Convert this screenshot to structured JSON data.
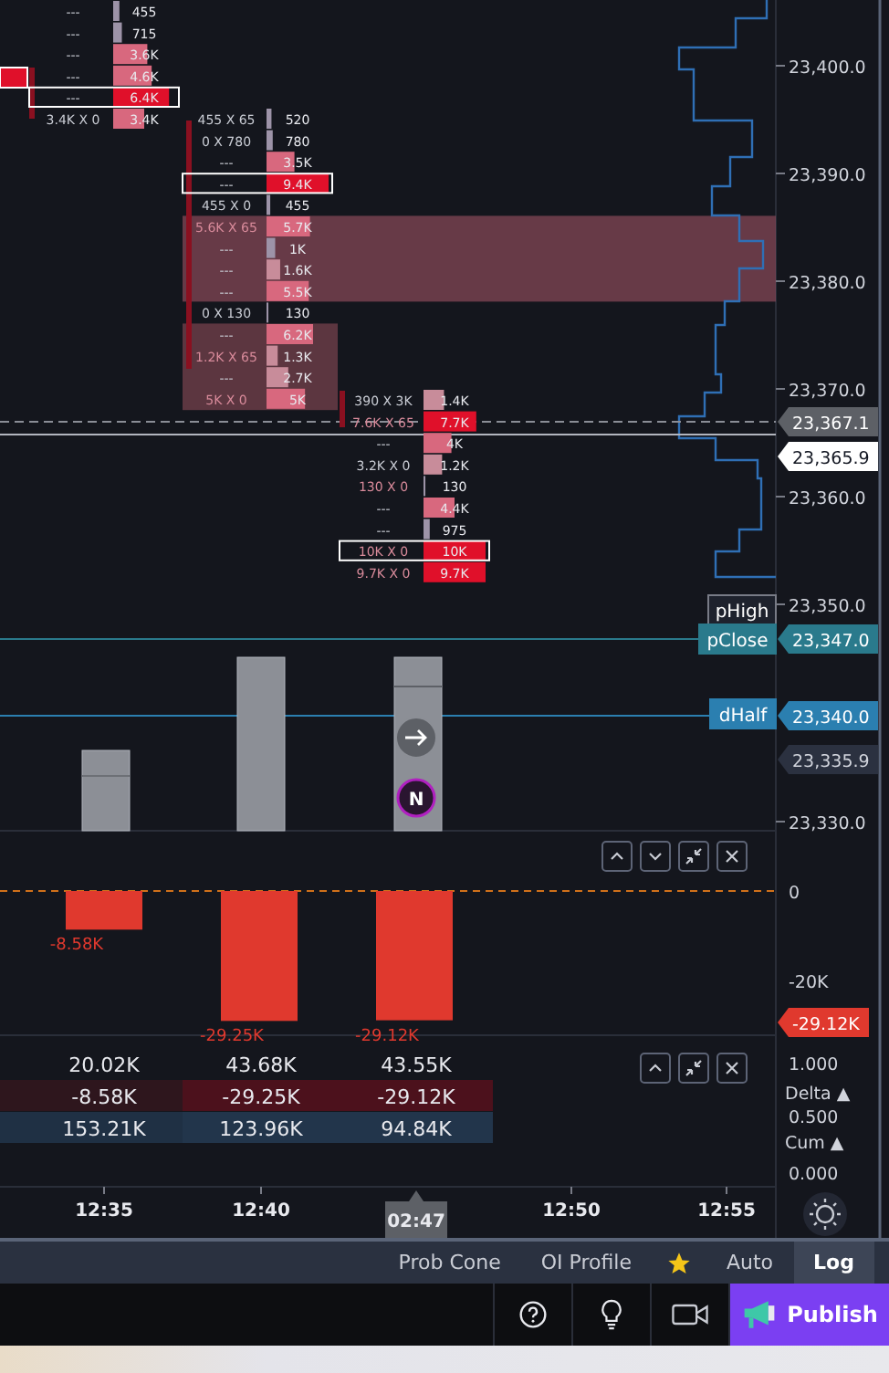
{
  "price_axis": {
    "ticks": [
      "23,400.0",
      "23,390.0",
      "23,380.0",
      "23,370.0",
      "23,360.0",
      "23,350.0",
      "23,330.0"
    ],
    "tags": [
      {
        "text": "23,367.1",
        "kind": "last"
      },
      {
        "text": "23,365.9",
        "kind": "current"
      },
      {
        "text": "23,347.0",
        "kind": "pclose"
      },
      {
        "text": "23,340.0",
        "kind": "dhalf"
      },
      {
        "text": "23,335.9",
        "kind": "marker"
      }
    ]
  },
  "level_labels": [
    {
      "text": "pHigh",
      "kind": "phigh"
    },
    {
      "text": "pClose",
      "kind": "pclose"
    },
    {
      "text": "dHalf",
      "kind": "dhalf"
    }
  ],
  "footprint": [
    {
      "rows": [
        {
          "bid_ask": "---",
          "volume": "455",
          "level": 0.1,
          "boxed": false,
          "bid_heavy": false
        },
        {
          "bid_ask": "---",
          "volume": "715",
          "level": 0.14,
          "boxed": false,
          "bid_heavy": false
        },
        {
          "bid_ask": "---",
          "volume": "3.6K",
          "level": 0.55,
          "boxed": false,
          "bid_heavy": false
        },
        {
          "bid_ask": "---",
          "volume": "4.6K",
          "level": 0.62,
          "boxed": false,
          "bid_heavy": false
        },
        {
          "bid_ask": "---",
          "volume": "6.4K",
          "level": 0.9,
          "boxed": true,
          "bid_heavy": false
        },
        {
          "bid_ask": "3.4K X 0",
          "volume": "3.4K",
          "level": 0.5,
          "boxed": false,
          "bid_heavy": false
        }
      ]
    },
    {
      "rows": [
        {
          "bid_ask": "455 X 65",
          "volume": "520",
          "level": 0.08,
          "boxed": false,
          "bid_heavy": false
        },
        {
          "bid_ask": "0 X 780",
          "volume": "780",
          "level": 0.1,
          "boxed": false,
          "bid_heavy": false
        },
        {
          "bid_ask": "---",
          "volume": "3.5K",
          "level": 0.45,
          "boxed": false,
          "bid_heavy": false
        },
        {
          "bid_ask": "---",
          "volume": "9.4K",
          "level": 1,
          "boxed": true,
          "bid_heavy": false
        },
        {
          "bid_ask": "455 X 0",
          "volume": "455",
          "level": 0.06,
          "boxed": false,
          "bid_heavy": false
        },
        {
          "bid_ask": "5.6K X 65",
          "volume": "5.7K",
          "level": 0.7,
          "boxed": false,
          "bid_heavy": true
        },
        {
          "bid_ask": "---",
          "volume": "1K",
          "level": 0.14,
          "boxed": false,
          "bid_heavy": false
        },
        {
          "bid_ask": "---",
          "volume": "1.6K",
          "level": 0.22,
          "boxed": false,
          "bid_heavy": false
        },
        {
          "bid_ask": "---",
          "volume": "5.5K",
          "level": 0.68,
          "boxed": false,
          "bid_heavy": false
        },
        {
          "bid_ask": "0 X 130",
          "volume": "130",
          "level": 0.03,
          "boxed": false,
          "bid_heavy": false
        },
        {
          "bid_ask": "---",
          "volume": "6.2K",
          "level": 0.75,
          "boxed": false,
          "bid_heavy": false
        },
        {
          "bid_ask": "1.2K X 65",
          "volume": "1.3K",
          "level": 0.18,
          "boxed": false,
          "bid_heavy": true
        },
        {
          "bid_ask": "---",
          "volume": "2.7K",
          "level": 0.35,
          "boxed": false,
          "bid_heavy": false
        },
        {
          "bid_ask": "5K X 0",
          "volume": "5K",
          "level": 0.62,
          "boxed": false,
          "bid_heavy": true
        }
      ]
    },
    {
      "rows": [
        {
          "bid_ask": "390 X 3K",
          "volume": "1.4K",
          "level": 0.33,
          "boxed": false,
          "bid_heavy": false
        },
        {
          "bid_ask": "7.6K X 65",
          "volume": "7.7K",
          "level": 0.85,
          "boxed": false,
          "bid_heavy": true
        },
        {
          "bid_ask": "---",
          "volume": "4K",
          "level": 0.45,
          "boxed": false,
          "bid_heavy": false
        },
        {
          "bid_ask": "3.2K X 0",
          "volume": "1.2K",
          "level": 0.3,
          "boxed": false,
          "bid_heavy": false
        },
        {
          "bid_ask": "130 X 0",
          "volume": "130",
          "level": 0.03,
          "boxed": false,
          "bid_heavy": true
        },
        {
          "bid_ask": "---",
          "volume": "4.4K",
          "level": 0.5,
          "boxed": false,
          "bid_heavy": false
        },
        {
          "bid_ask": "---",
          "volume": "975",
          "level": 0.1,
          "boxed": false,
          "bid_heavy": false
        },
        {
          "bid_ask": "10K X 0",
          "volume": "10K",
          "level": 1,
          "boxed": true,
          "bid_heavy": true
        },
        {
          "bid_ask": "9.7K X 0",
          "volume": "9.7K",
          "level": 1,
          "boxed": false,
          "bid_heavy": true
        }
      ]
    }
  ],
  "candle_badge": "N",
  "delta_pane": {
    "bars": [
      {
        "label": "-8.58K",
        "level": 0.29
      },
      {
        "label": "-29.25K",
        "level": 0.975
      },
      {
        "label": "-29.12K",
        "level": 0.97
      }
    ],
    "axis": [
      "0",
      "-20K"
    ],
    "tag": "-29.12K",
    "buttons": [
      {
        "kind": "up"
      },
      {
        "kind": "down"
      },
      {
        "kind": "collapse"
      },
      {
        "kind": "close"
      }
    ]
  },
  "stats_table": {
    "rows": [
      {
        "kind": "volume",
        "cells": [
          "20.02K",
          "43.68K",
          "43.55K"
        ]
      },
      {
        "kind": "delta",
        "cells": [
          "-8.58K",
          "-29.25K",
          "-29.12K"
        ]
      },
      {
        "kind": "cum",
        "cells": [
          "153.21K",
          "123.96K",
          "94.84K"
        ]
      }
    ],
    "axis": [
      "1.000",
      "0.500",
      "0.000"
    ],
    "legend": [
      "Delta ▲",
      "Cum ▲"
    ],
    "buttons": [
      {
        "kind": "up"
      },
      {
        "kind": "collapse"
      },
      {
        "kind": "close"
      }
    ]
  },
  "time_axis": {
    "ticks": [
      "12:35",
      "12:40",
      "12:50",
      "12:55"
    ],
    "cursor": "02:47"
  },
  "toolbar": [
    {
      "label": "Prob Cone",
      "kind": "text",
      "selected": false
    },
    {
      "label": "OI Profile",
      "kind": "text",
      "selected": false
    },
    {
      "kind": "star",
      "selected": false
    },
    {
      "label": "Auto",
      "kind": "text",
      "selected": false
    },
    {
      "label": "Log",
      "kind": "text",
      "selected": true
    }
  ],
  "publish_button": "Publish"
}
